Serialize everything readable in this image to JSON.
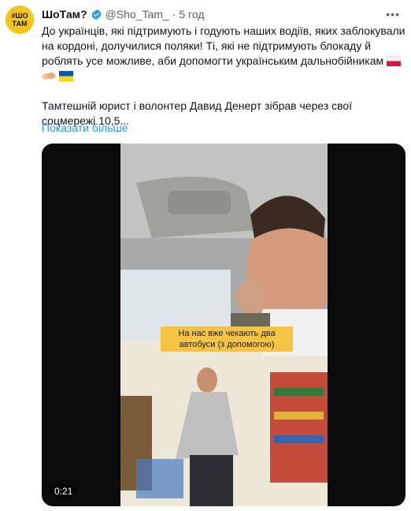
{
  "author": {
    "avatar_text_line1": "#ШО",
    "avatar_text_line2": "ТАМ",
    "name": "ШоТам?",
    "handle": "@Sho_Tam_",
    "separator": "·",
    "time": "5 год"
  },
  "tweet": {
    "paragraph1": "До українців, які підтримують і годують наших водіїв, яких заблокували на кордоні, долучилися поляки! Ті, які не підтримують блокаду й роблять усе можливе, аби допомогти українським дальнобійникам",
    "paragraph2": "Тамтешній юрист і волонтер Давид Денерт зібрав через свої соцмережі 10,5...",
    "show_more": "Показати більше"
  },
  "video": {
    "caption": "На нас вже чекають два автобуси (з допомогою)",
    "duration": "0:21"
  },
  "icons": {
    "verified": "verified-badge-icon",
    "more": "more-options-icon",
    "poland_flag": "poland-flag-icon",
    "handshake": "handshake-icon",
    "ukraine_flag": "ukraine-flag-icon"
  },
  "colors": {
    "link": "#1d9bf0",
    "secondary_text": "#536471",
    "avatar_bg": "#f5c518",
    "caption_bg": "#f6c443"
  }
}
